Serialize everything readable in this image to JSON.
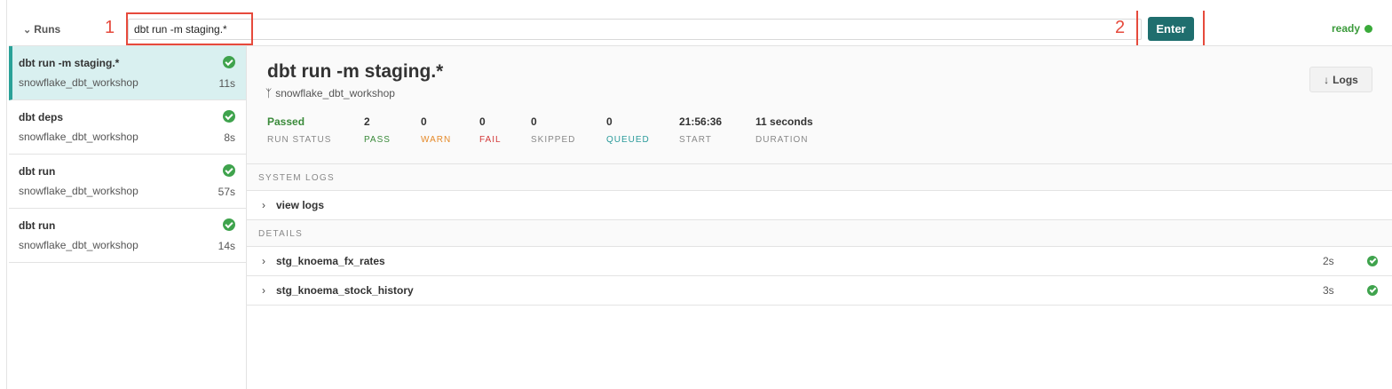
{
  "topbar": {
    "runs_label": "Runs",
    "command_value": "dbt run -m staging.*",
    "enter_label": "Enter",
    "status_text": "ready"
  },
  "annotations": [
    "1",
    "2"
  ],
  "sidebar": {
    "runs": [
      {
        "title": "dbt run -m staging.*",
        "project": "snowflake_dbt_workshop",
        "duration": "11s",
        "status": "success",
        "active": true
      },
      {
        "title": "dbt deps",
        "project": "snowflake_dbt_workshop",
        "duration": "8s",
        "status": "success",
        "active": false
      },
      {
        "title": "dbt run",
        "project": "snowflake_dbt_workshop",
        "duration": "57s",
        "status": "success",
        "active": false
      },
      {
        "title": "dbt run",
        "project": "snowflake_dbt_workshop",
        "duration": "14s",
        "status": "success",
        "active": false
      }
    ]
  },
  "main": {
    "title": "dbt run -m staging.*",
    "project": "snowflake_dbt_workshop",
    "logs_label": "Logs",
    "stats": {
      "run_status": {
        "value": "Passed",
        "label": "RUN STATUS"
      },
      "pass": {
        "value": "2",
        "label": "PASS"
      },
      "warn": {
        "value": "0",
        "label": "WARN"
      },
      "fail": {
        "value": "0",
        "label": "FAIL"
      },
      "skipped": {
        "value": "0",
        "label": "SKIPPED"
      },
      "queued": {
        "value": "0",
        "label": "QUEUED"
      },
      "start": {
        "value": "21:56:36",
        "label": "START"
      },
      "duration": {
        "value": "11 seconds",
        "label": "DURATION"
      }
    },
    "system_logs_label": "SYSTEM LOGS",
    "view_logs_label": "view logs",
    "details_label": "DETAILS",
    "details": [
      {
        "name": "stg_knoema_fx_rates",
        "duration": "2s",
        "status": "success"
      },
      {
        "name": "stg_knoema_stock_history",
        "duration": "3s",
        "status": "success"
      }
    ]
  },
  "colors": {
    "accent": "#1f6e6e",
    "active_row_bg": "#d9f0f0",
    "success": "#3fa34d",
    "annotation": "#e64a3c"
  },
  "icons": {
    "runs_toggle": "chevron-down-icon",
    "branch": "git-branch-icon",
    "logs": "arrow-down-icon",
    "expand": "chevron-right-icon",
    "status": "check-circle-icon"
  }
}
